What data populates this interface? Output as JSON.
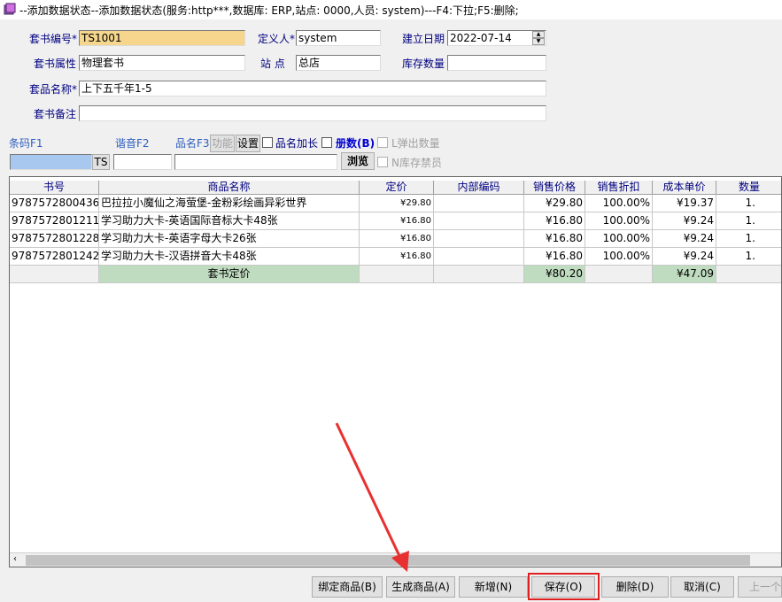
{
  "window": {
    "title": "--添加数据状态--添加数据状态(服务:http***,数据库: ERP,站点: 0000,人员: system)---F4:下拉;F5:删除;"
  },
  "form": {
    "set_code_label": "套书编号*",
    "set_code_value": "TS1001",
    "definer_label": "定义人*",
    "definer_value": "system",
    "created_date_label": "建立日期",
    "created_date_value": "2022-07-14",
    "set_property_label": "套书属性",
    "set_property_value": "物理套书",
    "site_label": "站 点",
    "site_value": "总店",
    "stock_qty_label": "库存数量",
    "stock_qty_value": "",
    "product_name_label": "套品名称*",
    "product_name_value": "上下五千年1-5",
    "set_note_label": "套书备注",
    "set_note_value": ""
  },
  "search": {
    "barcode_label": "条码F1",
    "pinyin_label": "谐音F2",
    "name_label": "品名F3",
    "function_button": "功能",
    "settings_button": "设置",
    "name_extend_label": "品名加长",
    "volumes_label": "册数(B)",
    "pop_qty_label": "L弹出数量",
    "barcode_suffix": "TS",
    "browse_button": "浏览",
    "stock_ban_label": "N库存禁员"
  },
  "table": {
    "headers": [
      "书号",
      "商品名称",
      "定价",
      "内部编码",
      "销售价格",
      "销售折扣",
      "成本单价",
      "数量"
    ],
    "rows": [
      [
        "9787572800436",
        "巴拉拉小魔仙之海萤堡-金粉彩绘画异彩世界",
        "¥29.80",
        "",
        "¥29.80",
        "100.00%",
        "¥19.37",
        "1."
      ],
      [
        "9787572801211",
        "学习助力大卡-英语国际音标大卡48张",
        "¥16.80",
        "",
        "¥16.80",
        "100.00%",
        "¥9.24",
        "1."
      ],
      [
        "9787572801228",
        "学习助力大卡-英语字母大卡26张",
        "¥16.80",
        "",
        "¥16.80",
        "100.00%",
        "¥9.24",
        "1."
      ],
      [
        "9787572801242",
        "学习助力大卡-汉语拼音大卡48张",
        "¥16.80",
        "",
        "¥16.80",
        "100.00%",
        "¥9.24",
        "1."
      ]
    ],
    "summary": {
      "label": "套书定价",
      "sale_total": "¥80.20",
      "cost_total": "¥47.09"
    }
  },
  "buttons": {
    "bind": "绑定商品(B)",
    "generate": "生成商品(A)",
    "add": "新增(N)",
    "save": "保存(O)",
    "delete": "删除(D)",
    "cancel": "取消(C)",
    "prev": "上一个"
  },
  "colors": {
    "highlight_border": "#e02020",
    "arrow": "#e83030",
    "required_field": "#f5d68c",
    "summary_fill": "#c0dcc0"
  },
  "icons": {
    "app": "app-icon",
    "arrow": "red-arrow-annotation"
  }
}
